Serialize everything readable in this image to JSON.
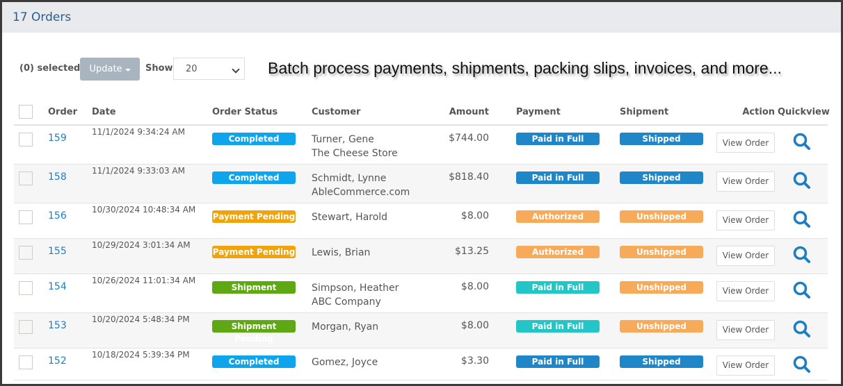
{
  "header": {
    "title": "17 Orders"
  },
  "toolbar": {
    "selected_label": "(0) selected",
    "update_label": "Update",
    "show_label": "Show",
    "show_value": "20",
    "promo_text": "Batch process payments, shipments, packing slips, invoices, and more..."
  },
  "table": {
    "columns": {
      "order": "Order",
      "date": "Date",
      "order_status": "Order Status",
      "customer": "Customer",
      "amount": "Amount",
      "payment": "Payment",
      "shipment": "Shipment",
      "action": "Action",
      "quickview": "Quickview"
    },
    "rows": [
      {
        "order": "159",
        "date": "11/1/2024 9:34:24 AM",
        "status": "Completed",
        "status_color": "#0ea5ec",
        "customer": "Turner, Gene",
        "company": "The Cheese Store",
        "amount": "$744.00",
        "payment": "Paid in Full",
        "payment_color": "#1f86c8",
        "shipment": "Shipped",
        "shipment_color": "#1f86c8",
        "action": "View Order"
      },
      {
        "order": "158",
        "date": "11/1/2024 9:33:03 AM",
        "status": "Completed",
        "status_color": "#0ea5ec",
        "customer": "Schmidt, Lynne",
        "company": "AbleCommerce.com",
        "amount": "$818.40",
        "payment": "Paid in Full",
        "payment_color": "#1f86c8",
        "shipment": "Shipped",
        "shipment_color": "#1f86c8",
        "action": "View Order"
      },
      {
        "order": "156",
        "date": "10/30/2024 10:48:34 AM",
        "status": "Payment Pending",
        "status_color": "#f0a30a",
        "customer": "Stewart, Harold",
        "company": "",
        "amount": "$8.00",
        "payment": "Authorized",
        "payment_color": "#f7aa59",
        "shipment": "Unshipped",
        "shipment_color": "#f7aa59",
        "action": "View Order"
      },
      {
        "order": "155",
        "date": "10/29/2024 3:01:34 AM",
        "status": "Payment Pending",
        "status_color": "#f0a30a",
        "customer": "Lewis, Brian",
        "company": "",
        "amount": "$13.25",
        "payment": "Authorized",
        "payment_color": "#f7aa59",
        "shipment": "Unshipped",
        "shipment_color": "#f7aa59",
        "action": "View Order"
      },
      {
        "order": "154",
        "date": "10/26/2024 11:01:34 AM",
        "status": "Shipment Pending",
        "status_color": "#5ea813",
        "customer": "Simpson, Heather",
        "company": "ABC Company",
        "amount": "$8.00",
        "payment": "Paid in Full",
        "payment_color": "#23c5c7",
        "shipment": "Unshipped",
        "shipment_color": "#f7aa59",
        "action": "View Order"
      },
      {
        "order": "153",
        "date": "10/20/2024 5:48:34 PM",
        "status": "Shipment Pending",
        "status_color": "#5ea813",
        "customer": "Morgan, Ryan",
        "company": "",
        "amount": "$8.00",
        "payment": "Paid in Full",
        "payment_color": "#23c5c7",
        "shipment": "Unshipped",
        "shipment_color": "#f7aa59",
        "action": "View Order"
      },
      {
        "order": "152",
        "date": "10/18/2024 5:39:34 PM",
        "status": "Completed",
        "status_color": "#0ea5ec",
        "customer": "Gomez, Joyce",
        "company": "",
        "amount": "$3.30",
        "payment": "Paid in Full",
        "payment_color": "#1f86c8",
        "shipment": "Shipped",
        "shipment_color": "#1f86c8",
        "action": "View Order"
      }
    ]
  },
  "icons": {
    "quickview": "search-icon",
    "dropdown": "chevron-down-icon"
  },
  "colors": {
    "link": "#1e7ec2",
    "header_bg": "#e8eaed",
    "header_text": "#2a5d8c"
  }
}
